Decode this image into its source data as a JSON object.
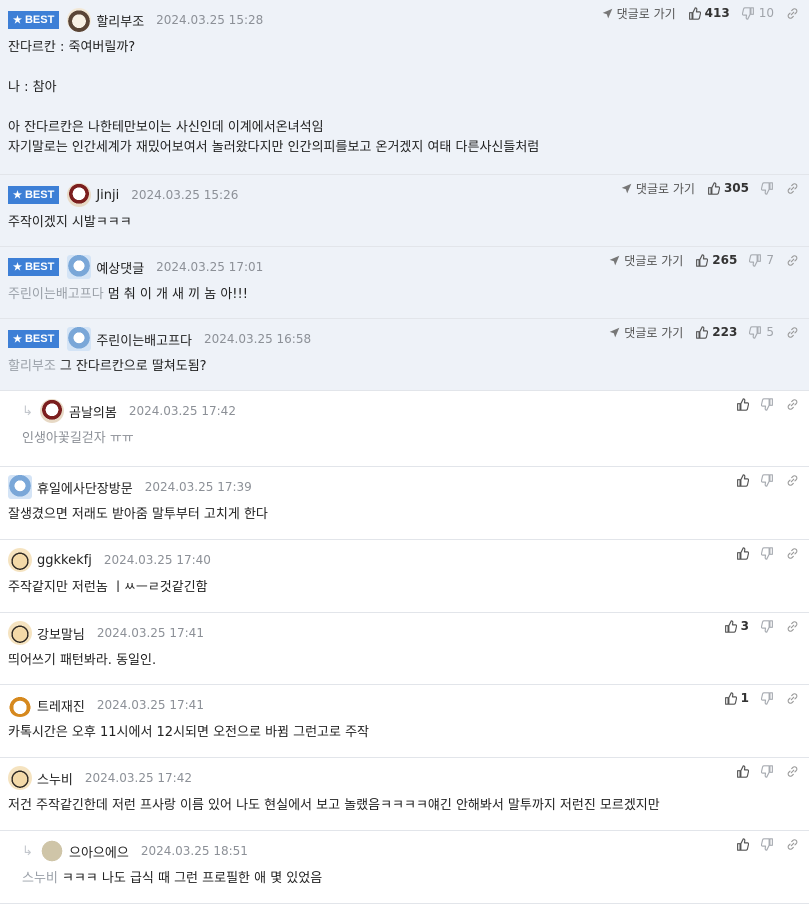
{
  "labels": {
    "best": "BEST",
    "goto": "댓글로 가기"
  },
  "comments": [
    {
      "best": true,
      "nick": "할리부조",
      "date": "2024.03.25 15:28",
      "avatar": "dog",
      "goto": true,
      "up": "413",
      "down": "10",
      "body": "잔다르칸 : 죽여버릴까?\n\n나 : 참아\n\n아 잔다르칸은 나한테만보이는 사신인데 이계에서온녀석임\n자기말로는 인간세계가 재밌어보여서 놀러왔다지만 인간의피를보고 온거겠지 여태 다른사신들처럼",
      "mention": ""
    },
    {
      "best": true,
      "nick": "Jinji",
      "date": "2024.03.25 15:26",
      "avatar": "bear",
      "goto": true,
      "up": "305",
      "down": "",
      "body": "주작이겠지 시발ㅋㅋㅋ",
      "mention": ""
    },
    {
      "best": true,
      "nick": "예상댓글",
      "date": "2024.03.25 17:01",
      "avatar": "blue",
      "goto": true,
      "up": "265",
      "down": "7",
      "body": "멈 춰 이 개 새 끼 놈 아!!!",
      "mention": "주린이는배고프다"
    },
    {
      "best": true,
      "nick": "주린이는배고프다",
      "date": "2024.03.25 16:58",
      "avatar": "blue",
      "goto": true,
      "up": "223",
      "down": "5",
      "body": "그 잔다르칸으로 딸쳐도됨?",
      "mention": "할리부조"
    },
    {
      "best": false,
      "reply": true,
      "nick": "곰날의봄",
      "date": "2024.03.25 17:42",
      "avatar": "bear",
      "goto": false,
      "up": "",
      "down": "",
      "body": "인생아꽃길걷자 ㅠㅠ",
      "mention": "",
      "muted": true
    },
    {
      "best": false,
      "nick": "휴일에사단장방문",
      "date": "2024.03.25 17:39",
      "avatar": "blue",
      "goto": false,
      "up": "",
      "down": "",
      "body": "잘생겼으면 저래도 받아줌 말투부터 고치게 한다",
      "mention": ""
    },
    {
      "best": false,
      "nick": "ggkkekfj",
      "date": "2024.03.25 17:40",
      "avatar": "puppy",
      "goto": false,
      "up": "",
      "down": "",
      "body": "주작같지만 저런놈 ㅣㅆㅡㄹ것같긴함",
      "mention": ""
    },
    {
      "best": false,
      "nick": "강보말님",
      "date": "2024.03.25 17:41",
      "avatar": "puppy",
      "goto": false,
      "up": "3",
      "down": "",
      "body": "띄어쓰기 패턴봐라. 동일인.",
      "mention": ""
    },
    {
      "best": false,
      "nick": "트레재진",
      "date": "2024.03.25 17:41",
      "avatar": "fox",
      "goto": false,
      "up": "1",
      "down": "",
      "body": "카톡시간은 오후 11시에서 12시되면 오전으로 바뀜 그런고로 주작",
      "mention": ""
    },
    {
      "best": false,
      "nick": "스누비",
      "date": "2024.03.25 17:42",
      "avatar": "puppy",
      "goto": false,
      "up": "",
      "down": "",
      "body": "저건 주작같긴한데 저런 프사랑 이름 있어 나도 현실에서 보고 놀랬음ㅋㅋㅋㅋ얘긴 안해봐서 말투까지 저런진 모르겠지만",
      "mention": ""
    },
    {
      "best": false,
      "reply": true,
      "nick": "으아으에으",
      "date": "2024.03.25 18:51",
      "avatar": "egg",
      "goto": false,
      "up": "",
      "down": "",
      "body": "ㅋㅋㅋ 나도 급식 때 그런 프로필한 애 몇 있었음",
      "mention": "스누비"
    }
  ]
}
